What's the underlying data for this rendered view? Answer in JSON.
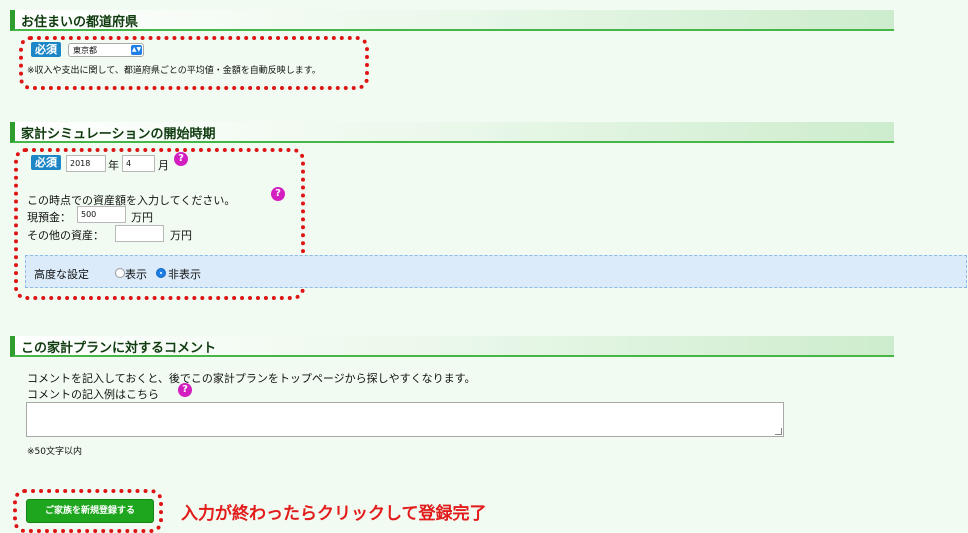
{
  "section_residence": {
    "title": "お住まいの都道府県",
    "required_badge": "必須",
    "prefecture_value": "東京都",
    "note": "※収入や支出に関して、都道府県ごとの平均値・金額を自動反映します。"
  },
  "section_start": {
    "title": "家計シミュレーションの開始時期",
    "required_badge": "必須",
    "year_value": "2018",
    "year_unit": "年",
    "month_value": "4",
    "month_unit": "月",
    "assets_prompt": "この時点での資産額を入力してください。",
    "cash_label": "現預金：",
    "cash_value": "500",
    "cash_unit": "万円",
    "other_assets_label": "その他の資産：",
    "other_assets_value": "",
    "other_assets_unit": "万円",
    "advanced_label": "高度な設定",
    "advanced_show": "表示",
    "advanced_hide": "非表示",
    "advanced_selected": "非表示"
  },
  "section_comment": {
    "title": "この家計プランに対するコメント",
    "description": "コメントを記入しておくと、後でこの家計プランをトップページから探しやすくなります。",
    "example_link": "コメントの記入例はこちら",
    "comment_value": "",
    "limit_note": "※50文字以内"
  },
  "help_icon": "?",
  "submit_label": "ご家族を新規登録する",
  "callout": "入力が終わったらクリックして登録完了",
  "colors": {
    "accent_green": "#1ea71e",
    "badge_blue": "#1c86c6",
    "help_magenta": "#d31ec0",
    "annotation_red": "#dd1515"
  }
}
